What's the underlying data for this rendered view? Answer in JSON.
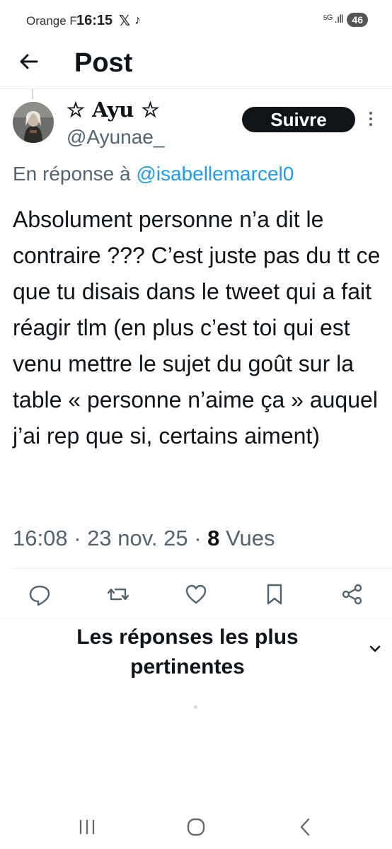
{
  "status_bar": {
    "carrier": "Orange F",
    "time": "16:15",
    "x_glyph": "𝕏",
    "tiktok_glyph": "♪",
    "network": "⁵ᴳ .ıll",
    "battery": "46"
  },
  "header": {
    "title": "Post"
  },
  "post": {
    "author_name": "☆ Ayu ☆",
    "author_handle": "@Ayunae_",
    "follow_label": "Suivre",
    "reply_prefix": "En réponse à ",
    "reply_mention": "@isabellemarcel0",
    "text": "Absolument personne n’a dit le contraire ??? C’est juste pas du tt ce que tu disais dans le tweet qui a fait réagir tlm (en plus c’est toi qui est venu mettre le sujet du goût sur la table « personne n’aime ça » auquel j’ai rep que si, certains aiment)",
    "timestamp": "16:08 · 23 nov. 25 · ",
    "views_count": "8",
    "views_label": " Vues"
  },
  "actions": {
    "icons": [
      "reply-icon",
      "retweet-icon",
      "like-icon",
      "bookmark-icon",
      "share-icon"
    ]
  },
  "replies": {
    "sort_label": "Les réponses les plus pertinentes"
  },
  "colors": {
    "accent": "#1d9bf0",
    "secondary_text": "#536471",
    "primary_text": "#0f1419"
  }
}
